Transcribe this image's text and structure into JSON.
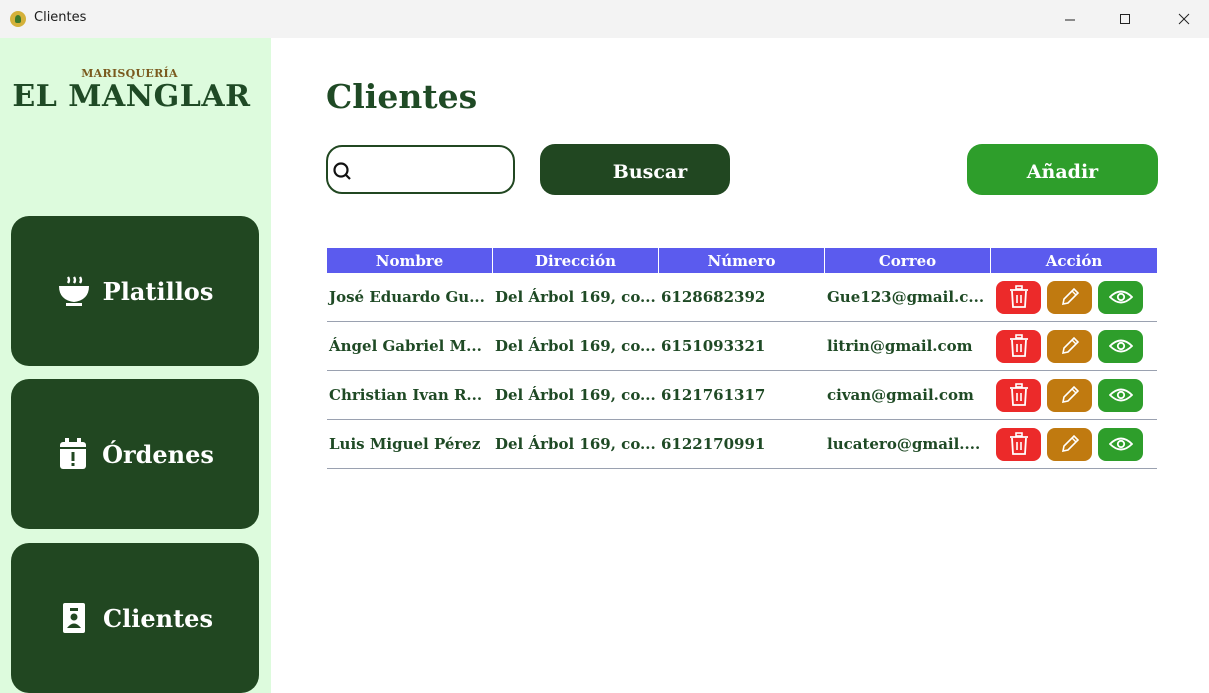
{
  "window": {
    "title": "Clientes"
  },
  "sidebar": {
    "brand_small": "MARISQUERÍA",
    "brand_big": "EL MANGLAR",
    "items": [
      {
        "label": "Platillos",
        "icon": "dish-icon"
      },
      {
        "label": "Órdenes",
        "icon": "calendar-alert-icon"
      },
      {
        "label": "Clientes",
        "icon": "contact-card-icon"
      }
    ]
  },
  "main": {
    "title": "Clientes",
    "search": {
      "value": "",
      "placeholder": ""
    },
    "search_button": "Buscar",
    "add_button": "Añadir"
  },
  "table": {
    "headers": [
      "Nombre",
      "Dirección",
      "Número",
      "Correo",
      "Acción"
    ],
    "rows": [
      {
        "nombre": "José Eduardo Gu...",
        "direccion": "Del Árbol 169, co...",
        "numero": "6128682392",
        "correo": "Gue123@gmail.c..."
      },
      {
        "nombre": "Ángel Gabriel M...",
        "direccion": "Del Árbol 169, co...",
        "numero": "6151093321",
        "correo": "litrin@gmail.com"
      },
      {
        "nombre": "Christian Ivan R...",
        "direccion": "Del Árbol 169, co...",
        "numero": "6121761317",
        "correo": "civan@gmail.com"
      },
      {
        "nombre": "Luis Miguel Pérez",
        "direccion": "Del Árbol 169, co...",
        "numero": "6122170991",
        "correo": "lucatero@gmail...."
      }
    ]
  },
  "colors": {
    "sidebar_bg": "#ddfbdd",
    "dark_green": "#214721",
    "accent_green": "#2e9e2b",
    "header_blue": "#5b5bee",
    "delete_red": "#ec2a2a",
    "edit_orange": "#c07a10"
  }
}
